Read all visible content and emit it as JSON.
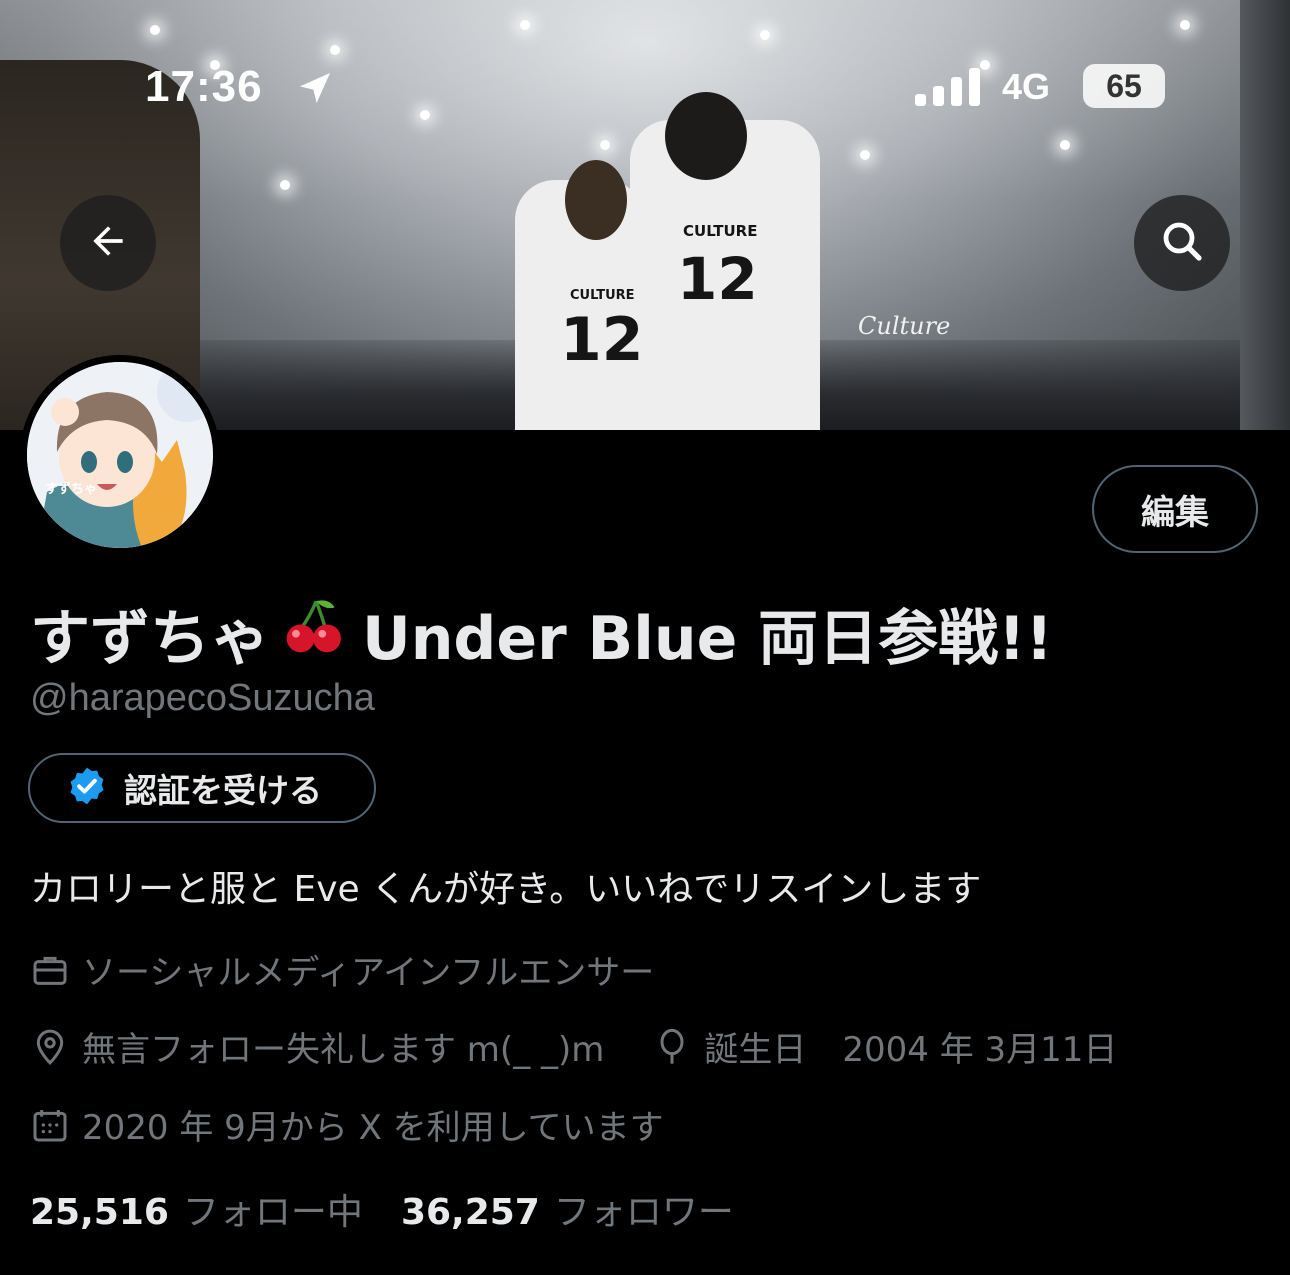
{
  "status_bar": {
    "time": "17:36",
    "network": "4G",
    "battery": "65",
    "icons": [
      "location-arrow-icon",
      "signal-bars-icon"
    ]
  },
  "banner": {
    "jersey_text": "CULTURE",
    "jersey_number": "12",
    "stage_logo": "Culture"
  },
  "header_buttons": {
    "back_icon": "arrow-left-icon",
    "search_icon": "magnifier-icon"
  },
  "profile": {
    "display_name": "すずちゃ",
    "display_name_suffix": "Under Blue 両日参戦!!",
    "emoji": "cherry",
    "handle": "@harapecoSuzucha",
    "edit_label": "編集",
    "verify_label": "認証を受ける",
    "bio": "カロリーと服と Eve くんが好き。いいねでリスインします",
    "category": "ソーシャルメディアインフルエンサー",
    "location": "無言フォロー失礼します m(_ _)m",
    "birthday_label": "誕生日",
    "birthday": "2004 年 3月11日",
    "joined": "2020 年 9月から X を利用しています",
    "following_count": "25,516",
    "following_label": "フォロー中",
    "followers_count": "36,257",
    "followers_label": "フォロワー",
    "avatar_text": "すずちゃ"
  },
  "colors": {
    "background": "#000000",
    "text_primary": "#e7e9ea",
    "text_secondary": "#71767b",
    "border": "#536471",
    "verified_blue": "#1d9bf0"
  }
}
